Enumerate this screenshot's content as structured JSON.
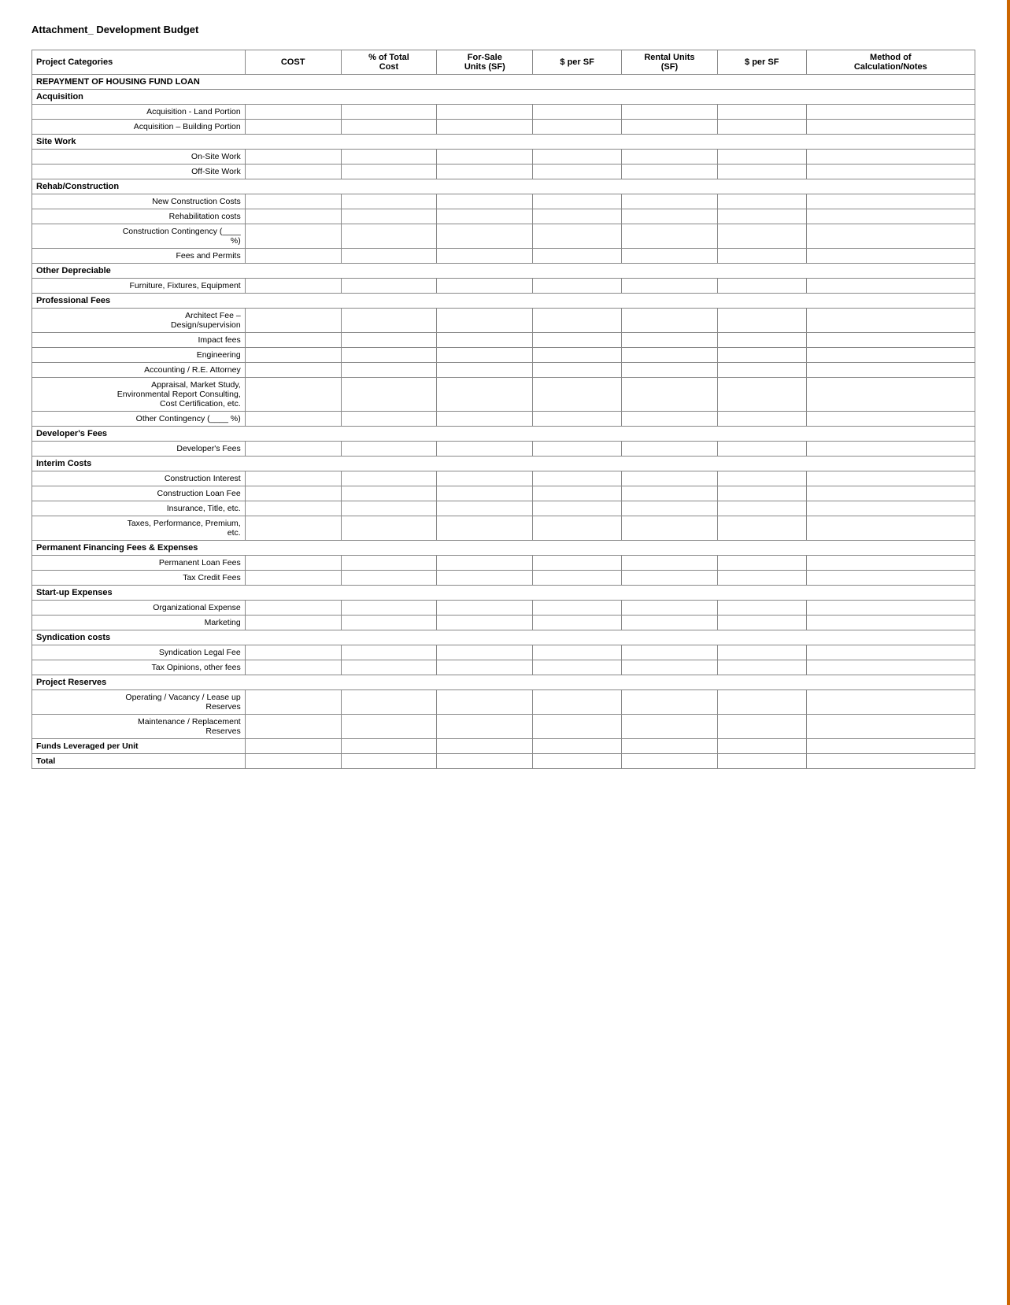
{
  "page": {
    "title": "Attachment_ Development Budget"
  },
  "table": {
    "headers": [
      {
        "id": "category",
        "label": "Project Categories"
      },
      {
        "id": "cost",
        "label": "COST"
      },
      {
        "id": "pct",
        "label": "% of Total Cost"
      },
      {
        "id": "forsale",
        "label": "For-Sale Units (SF)"
      },
      {
        "id": "persf1",
        "label": "$ per SF"
      },
      {
        "id": "rental",
        "label": "Rental Units (SF)"
      },
      {
        "id": "persf2",
        "label": "$ per SF"
      },
      {
        "id": "method",
        "label": "Method of Calculation/Notes"
      }
    ],
    "sections": [
      {
        "type": "header",
        "label": "REPAYMENT OF HOUSING FUND LOAN",
        "bold": true
      },
      {
        "type": "section",
        "label": "Acquisition"
      },
      {
        "type": "row",
        "label": "Acquisition - Land Portion"
      },
      {
        "type": "row",
        "label": "Acquisition – Building Portion"
      },
      {
        "type": "section",
        "label": "Site Work"
      },
      {
        "type": "row",
        "label": "On-Site Work"
      },
      {
        "type": "row",
        "label": "Off-Site Work"
      },
      {
        "type": "section",
        "label": "Rehab/Construction"
      },
      {
        "type": "row",
        "label": "New Construction Costs"
      },
      {
        "type": "row",
        "label": "Rehabilitation costs"
      },
      {
        "type": "row",
        "label": "Construction Contingency (____\n%)"
      },
      {
        "type": "row",
        "label": "Fees and Permits"
      },
      {
        "type": "section",
        "label": "Other Depreciable"
      },
      {
        "type": "row",
        "label": "Furniture, Fixtures, Equipment"
      },
      {
        "type": "section",
        "label": "Professional Fees"
      },
      {
        "type": "row",
        "label": "Architect Fee –\nDesign/supervision"
      },
      {
        "type": "row",
        "label": "Impact fees"
      },
      {
        "type": "row",
        "label": "Engineering"
      },
      {
        "type": "row",
        "label": "Accounting / R.E. Attorney"
      },
      {
        "type": "row",
        "label": "Appraisal, Market Study,\nEnvironmental Report Consulting,\nCost Certification, etc."
      },
      {
        "type": "row",
        "label": "Other Contingency (____ %)"
      },
      {
        "type": "section",
        "label": "Developer's Fees"
      },
      {
        "type": "row",
        "label": "Developer's Fees"
      },
      {
        "type": "section",
        "label": "Interim Costs"
      },
      {
        "type": "row",
        "label": "Construction Interest"
      },
      {
        "type": "row",
        "label": "Construction Loan Fee"
      },
      {
        "type": "row",
        "label": "Insurance, Title, etc."
      },
      {
        "type": "row",
        "label": "Taxes, Performance, Premium,\netc."
      },
      {
        "type": "section",
        "label": "Permanent Financing Fees & Expenses"
      },
      {
        "type": "row",
        "label": "Permanent Loan Fees"
      },
      {
        "type": "row",
        "label": "Tax Credit Fees"
      },
      {
        "type": "section",
        "label": "Start-up Expenses"
      },
      {
        "type": "row",
        "label": "Organizational Expense"
      },
      {
        "type": "row",
        "label": "Marketing"
      },
      {
        "type": "section",
        "label": "Syndication costs"
      },
      {
        "type": "row",
        "label": "Syndication Legal Fee"
      },
      {
        "type": "row",
        "label": "Tax Opinions, other fees"
      },
      {
        "type": "section",
        "label": "Project Reserves"
      },
      {
        "type": "row",
        "label": "Operating / Vacancy / Lease up\nReserves"
      },
      {
        "type": "row",
        "label": "Maintenance / Replacement\nReserves"
      },
      {
        "type": "bold-row",
        "label": "Funds Leveraged per Unit"
      },
      {
        "type": "bold-row",
        "label": "Total"
      }
    ]
  }
}
